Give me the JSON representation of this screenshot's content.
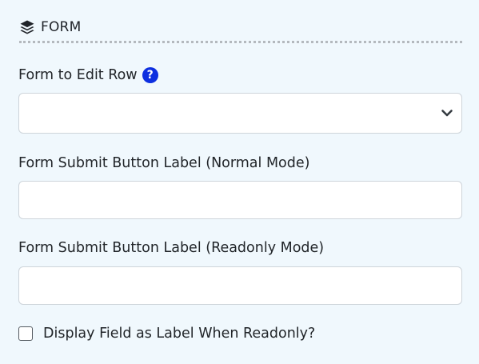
{
  "section": {
    "icon": "layers-icon",
    "title": "FORM"
  },
  "form_to_edit_row": {
    "label": "Form to Edit Row",
    "help_icon": "question-circle-icon",
    "help_glyph": "?",
    "selected_value": ""
  },
  "submit_label_normal": {
    "label": "Form Submit Button Label (Normal Mode)",
    "value": ""
  },
  "submit_label_readonly": {
    "label": "Form Submit Button Label (Readonly Mode)",
    "value": ""
  },
  "display_field_as_label": {
    "label": "Display Field as Label When Readonly?",
    "checked": false
  },
  "colors": {
    "background": "#f0f8fd",
    "help_icon": "#0d2fe0",
    "border": "#ced4da"
  }
}
